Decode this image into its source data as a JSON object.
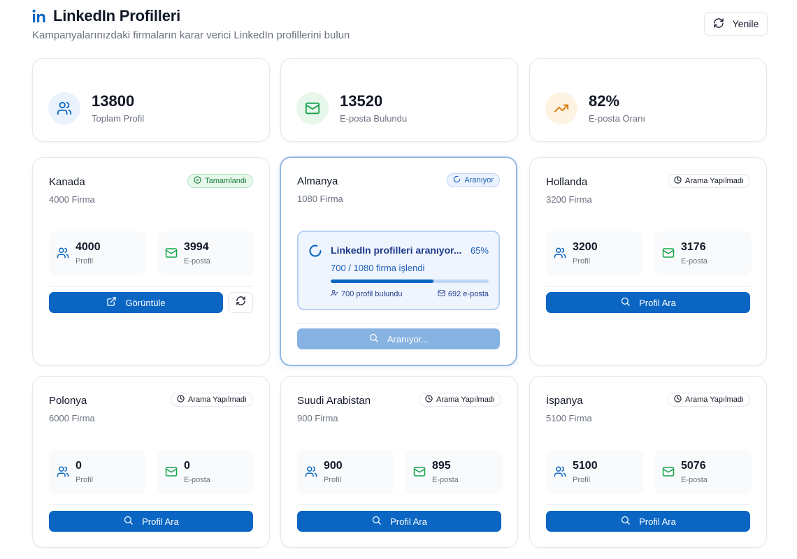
{
  "header": {
    "title": "LinkedIn Profilleri",
    "subtitle": "Kampanyalarınızdaki firmaların karar verici LinkedIn profillerini bulun",
    "refresh_label": "Yenile"
  },
  "stats": [
    {
      "value": "13800",
      "label": "Toplam Profil",
      "icon": "users-icon"
    },
    {
      "value": "13520",
      "label": "E-posta Bulundu",
      "icon": "mail-icon"
    },
    {
      "value": "82%",
      "label": "E-posta Oranı",
      "icon": "trending-up-icon"
    }
  ],
  "colors": {
    "primary": "#0a66c2",
    "success": "#16a34a",
    "warning": "#d97706"
  },
  "countries": [
    {
      "name": "Kanada",
      "firms": "4000 Firma",
      "status": "Tamamlandı",
      "profiles": "4000",
      "profiles_label": "Profil",
      "emails": "3994",
      "emails_label": "E-posta",
      "action": "Görüntüle"
    },
    {
      "name": "Almanya",
      "firms": "1080 Firma",
      "status": "Aranıyor",
      "action": "Aranıyor...",
      "progress": {
        "title": "LinkedIn profilleri aranıyor...",
        "percent_label": "65%",
        "percent": 0.65,
        "processed": "700 / 1080 firma işlendi",
        "found_profiles": "700 profil bulundu",
        "found_emails": "692 e-posta"
      }
    },
    {
      "name": "Hollanda",
      "firms": "3200 Firma",
      "status": "Arama Yapılmadı",
      "profiles": "3200",
      "profiles_label": "Profil",
      "emails": "3176",
      "emails_label": "E-posta",
      "action": "Profil Ara"
    },
    {
      "name": "Polonya",
      "firms": "6000 Firma",
      "status": "Arama Yapılmadı",
      "profiles": "0",
      "profiles_label": "Profil",
      "emails": "0",
      "emails_label": "E-posta",
      "action": "Profil Ara"
    },
    {
      "name": "Suudi Arabistan",
      "firms": "900 Firma",
      "status": "Arama Yapılmadı",
      "profiles": "900",
      "profiles_label": "Profil",
      "emails": "895",
      "emails_label": "E-posta",
      "action": "Profil Ara"
    },
    {
      "name": "İspanya",
      "firms": "5100 Firma",
      "status": "Arama Yapılmadı",
      "profiles": "5100",
      "profiles_label": "Profil",
      "emails": "5076",
      "emails_label": "E-posta",
      "action": "Profil Ara"
    }
  ]
}
